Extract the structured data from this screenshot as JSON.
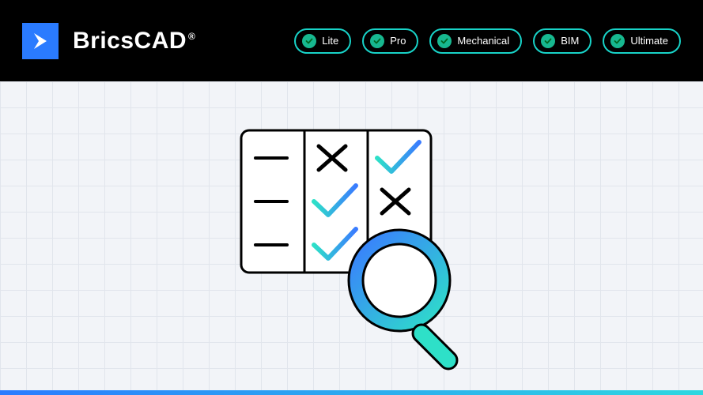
{
  "brand": {
    "name": "BricsCAD",
    "trademark": "®"
  },
  "editions": [
    {
      "label": "Lite"
    },
    {
      "label": "Pro"
    },
    {
      "label": "Mechanical"
    },
    {
      "label": "BIM"
    },
    {
      "label": "Ultimate"
    }
  ]
}
